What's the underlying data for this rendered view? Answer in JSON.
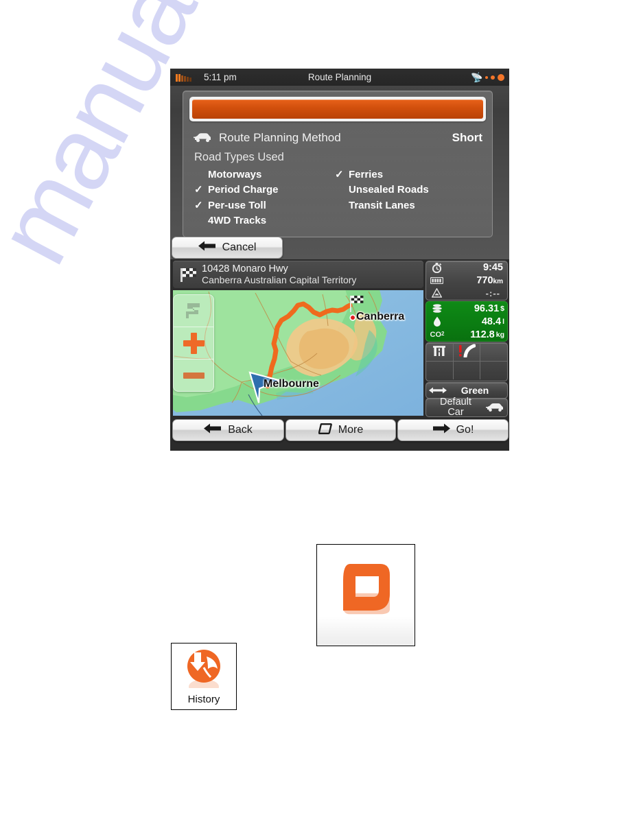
{
  "device": {
    "statusbar": {
      "time": "5:11 pm",
      "title": "Route Planning",
      "signal_icon": "signal-bars-icon",
      "satellite_icon": "satellite-icon",
      "accent_color": "#f4762a"
    },
    "settings": {
      "progress_color": "#d2500d",
      "method": {
        "icon": "car-icon",
        "label": "Route Planning Method",
        "value": "Short"
      },
      "road_types_title": "Road Types Used",
      "road_types": {
        "left": [
          {
            "label": "Motorways",
            "checked": false
          },
          {
            "label": "Period Charge",
            "checked": true
          },
          {
            "label": "Per-use Toll",
            "checked": true
          },
          {
            "label": "4WD Tracks",
            "checked": false
          }
        ],
        "right": [
          {
            "label": "Ferries",
            "checked": true
          },
          {
            "label": "Unsealed Roads",
            "checked": false
          },
          {
            "label": "Transit Lanes",
            "checked": false
          }
        ]
      },
      "cancel_label": "Cancel",
      "cancel_icon": "arrow-left-icon"
    },
    "map_view": {
      "destination": {
        "icon": "checkered-flag-icon",
        "line1": "10428 Monaro Hwy",
        "line2": "Canberra Australian Capital Territory"
      },
      "map": {
        "labels": [
          {
            "name": "Canberra",
            "type": "city"
          },
          {
            "name": "Melbourne",
            "type": "city"
          }
        ],
        "route_color": "#ef6a1e",
        "zoom_in_icon": "plus-icon",
        "zoom_out_icon": "minus-icon",
        "square_icon": "map-shape-icon",
        "vehicle_icon": "position-arrow-icon",
        "destination_flag_icon": "checkered-flag-icon"
      },
      "info": {
        "eta": [
          {
            "icon": "stopwatch-icon",
            "value": "9:45",
            "unit": ""
          },
          {
            "icon": "distance-icon",
            "value": "770",
            "unit": "km"
          },
          {
            "icon": "warning-triangle-icon",
            "value": "-:--",
            "unit": ""
          }
        ],
        "green_panel": {
          "background": "#0b7d12",
          "rows": [
            {
              "icon": "money-stack-icon",
              "value": "96.31",
              "unit": "$"
            },
            {
              "icon": "fuel-drop-icon",
              "value": "48.4",
              "unit": "l"
            },
            {
              "icon": "co2-label",
              "icon_text": "CO",
              "icon_sub": "2",
              "value": "112.8",
              "unit": "kg"
            }
          ]
        },
        "grid_icons": [
          "motorway-icon",
          "warning-curve-icon",
          "",
          "",
          "",
          ""
        ],
        "route_profile": {
          "icon": "route-alternatives-icon",
          "label": "Green"
        },
        "vehicle": {
          "label_line1": "Default",
          "label_line2": "Car",
          "icon": "car-icon"
        }
      },
      "buttons": [
        {
          "icon": "arrow-left-icon",
          "label": "Back"
        },
        {
          "icon": "rounded-square-icon",
          "label": "More"
        },
        {
          "icon": "arrow-right-icon",
          "label": "Go!"
        }
      ]
    }
  },
  "figures": {
    "logo": {
      "name": "app-logo-icon",
      "color": "#ef6724"
    },
    "history_button": {
      "label": "History",
      "icon": "history-arrow-icon",
      "color": "#ef6724"
    }
  },
  "watermark": {
    "text": "manualslive.com"
  }
}
